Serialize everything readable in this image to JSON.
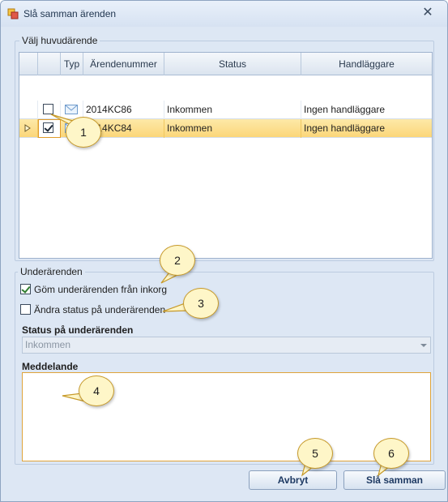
{
  "window": {
    "title": "Slå samman ärenden",
    "close_glyph": "✕"
  },
  "main_case_group": {
    "legend": "Välj huvudärende",
    "columns": [
      "Typ",
      "Ärendenummer",
      "Status",
      "Handläggare"
    ],
    "rows": [
      {
        "checked": false,
        "selected": false,
        "type_icon": "envelope-icon",
        "case_number": "2014KC86",
        "status": "Inkommen",
        "handler": "Ingen handläggare"
      },
      {
        "checked": true,
        "selected": true,
        "type_icon": "envelope-icon",
        "case_number": "2014KC84",
        "status": "Inkommen",
        "handler": "Ingen handläggare"
      }
    ]
  },
  "sub_case_group": {
    "legend": "Underärenden",
    "hide_from_inbox": {
      "label": "Göm underärenden från inkorg",
      "checked": true
    },
    "change_status": {
      "label": "Ändra status på underärenden",
      "checked": false
    },
    "status_label": "Status på underärenden",
    "status_value": "Inkommen",
    "message_label": "Meddelande",
    "message_value": ""
  },
  "buttons": {
    "cancel": "Avbryt",
    "merge": "Slå samman"
  },
  "callouts": [
    "1",
    "2",
    "3",
    "4",
    "5",
    "6"
  ],
  "colors": {
    "selection": "#fbd679",
    "callout_fill": "#fef6c8",
    "callout_border": "#c79a2a",
    "memo_border": "#e0a43a"
  }
}
